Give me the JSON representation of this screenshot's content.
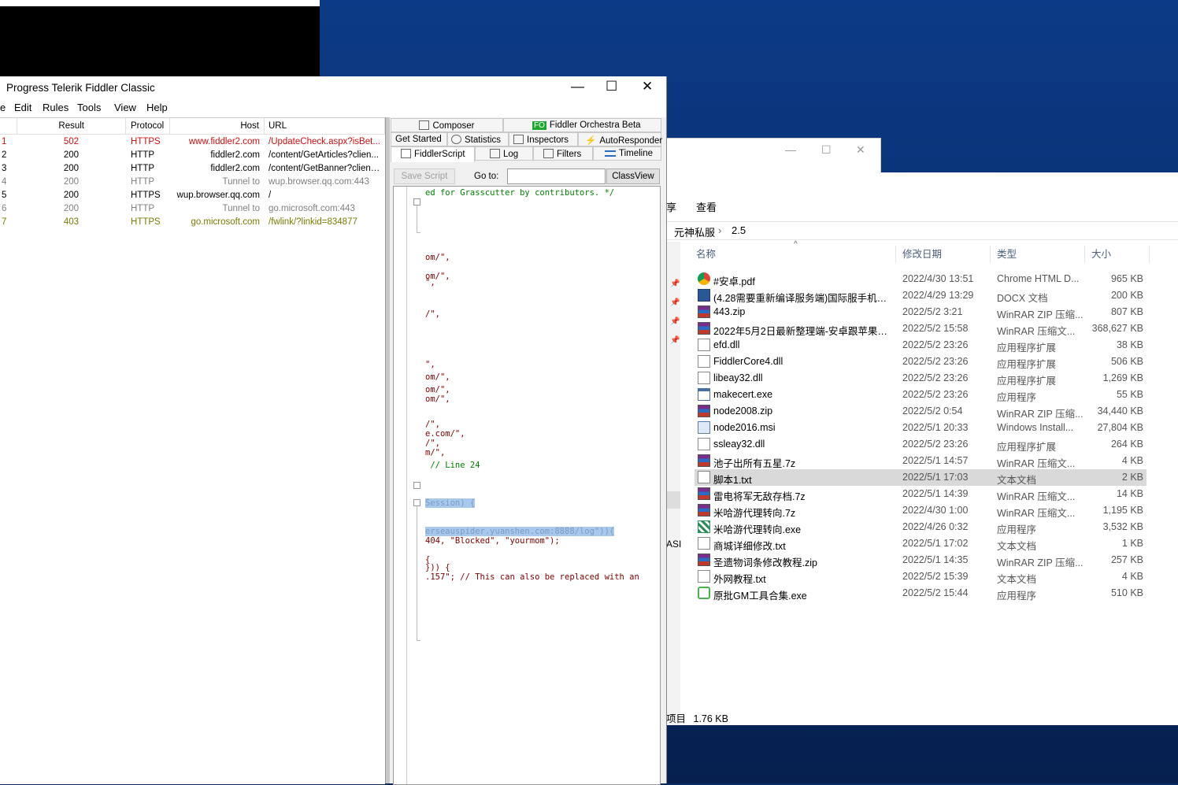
{
  "fiddler": {
    "title": "Progress Telerik Fiddler Classic",
    "window_controls": {
      "minimize": "—",
      "maximize": "☐",
      "close": "✕"
    },
    "menu": [
      "e",
      "Edit",
      "Rules",
      "Tools",
      "View",
      "Help"
    ],
    "columns": {
      "result": "Result",
      "protocol": "Protocol",
      "host": "Host",
      "url": "URL"
    },
    "sessions": [
      {
        "id": "1",
        "result": "502",
        "protocol": "HTTPS",
        "host": "www.fiddler2.com",
        "url": "/UpdateCheck.aspx?isBet...",
        "color": "#d01010"
      },
      {
        "id": "2",
        "result": "200",
        "protocol": "HTTP",
        "host": "fiddler2.com",
        "url": "/content/GetArticles?clien...",
        "color": "#000000"
      },
      {
        "id": "3",
        "result": "200",
        "protocol": "HTTP",
        "host": "fiddler2.com",
        "url": "/content/GetBanner?client...",
        "color": "#000000"
      },
      {
        "id": "4",
        "result": "200",
        "protocol": "HTTP",
        "host": "Tunnel to",
        "url": "wup.browser.qq.com:443",
        "color": "#808080"
      },
      {
        "id": "5",
        "result": "200",
        "protocol": "HTTPS",
        "host": "wup.browser.qq.com",
        "url": "/",
        "color": "#000000"
      },
      {
        "id": "6",
        "result": "200",
        "protocol": "HTTP",
        "host": "Tunnel to",
        "url": "go.microsoft.com:443",
        "color": "#808080"
      },
      {
        "id": "7",
        "result": "403",
        "protocol": "HTTPS",
        "host": "go.microsoft.com",
        "url": "/fwlink/?linkid=834877",
        "color": "#7a7a00"
      }
    ],
    "tabs_row1": [
      "Composer",
      "Fiddler Orchestra Beta"
    ],
    "fo_badge": "FO",
    "tabs_row2": [
      "Get Started",
      "Statistics",
      "Inspectors",
      "AutoResponder"
    ],
    "tabs_row3": [
      "FiddlerScript",
      "Log",
      "Filters",
      "Timeline"
    ],
    "toolbar": {
      "save_script": "Save Script",
      "goto_label": "Go to:",
      "goto_value": "",
      "classview": "ClassView"
    },
    "script_lines": [
      {
        "text": "ed for Grasscutter by contributors. */",
        "style": "cm"
      },
      {
        "text": "om/\",",
        "style": ""
      },
      {
        "text": "om/\",",
        "style": ""
      },
      {
        "text": "\",",
        "style": ""
      },
      {
        "text": "/\",",
        "style": ""
      },
      {
        "text": "\",",
        "style": ""
      },
      {
        "text": "om/\",",
        "style": ""
      },
      {
        "text": "om/\",",
        "style": ""
      },
      {
        "text": "om/\",",
        "style": ""
      },
      {
        "text": "/\",",
        "style": ""
      },
      {
        "text": "e.com/\",",
        "style": ""
      },
      {
        "text": "/\",",
        "style": ""
      },
      {
        "text": "m/\",",
        "style": ""
      },
      {
        "text": " // Line 24",
        "style": "cm"
      },
      {
        "text": "Session) {",
        "style": "sel"
      },
      {
        "text": "erseauspider.yuanshen.com:8888/log\")){",
        "style": "sel"
      },
      {
        "text": "404, \"Blocked\", \"yourmom\");",
        "style": ""
      },
      {
        "text": "{",
        "style": ""
      },
      {
        "text": "})) {",
        "style": ""
      },
      {
        "text": ".157\"; // This can also be replaced with an",
        "style": ""
      }
    ]
  },
  "explorer": {
    "window_controls": {
      "minimize": "—",
      "maximize": "☐",
      "close": "✕"
    },
    "ribbon": {
      "share": "享",
      "view": "查看"
    },
    "path": {
      "crumb1": "元神私服",
      "separator": "›",
      "crumb2": "2.5"
    },
    "sort_arrow": "^",
    "columns": {
      "name": "名称",
      "date": "修改日期",
      "type": "类型",
      "size": "大小"
    },
    "files": [
      {
        "name": "#安卓.pdf",
        "date": "2022/4/30 13:51",
        "type": "Chrome HTML D...",
        "size": "965 KB",
        "icon": "pdf-icon"
      },
      {
        "name": "(4.28需要重新编译服务端)国际服手机教...",
        "date": "2022/4/29 13:29",
        "type": "DOCX 文档",
        "size": "200 KB",
        "icon": "doc-icon"
      },
      {
        "name": "443.zip",
        "date": "2022/5/2 3:21",
        "type": "WinRAR ZIP 压缩...",
        "size": "807 KB",
        "icon": "rar-icon"
      },
      {
        "name": "2022年5月2日最新整理端-安卓跟苹果跟...",
        "date": "2022/5/2 15:58",
        "type": "WinRAR 压缩文...",
        "size": "368,627 KB",
        "icon": "rar-icon"
      },
      {
        "name": "efd.dll",
        "date": "2022/5/2 23:26",
        "type": "应用程序扩展",
        "size": "38 KB",
        "icon": "dll-icon"
      },
      {
        "name": "FiddlerCore4.dll",
        "date": "2022/5/2 23:26",
        "type": "应用程序扩展",
        "size": "506 KB",
        "icon": "dll-icon"
      },
      {
        "name": "libeay32.dll",
        "date": "2022/5/2 23:26",
        "type": "应用程序扩展",
        "size": "1,269 KB",
        "icon": "dll-icon"
      },
      {
        "name": "makecert.exe",
        "date": "2022/5/2 23:26",
        "type": "应用程序",
        "size": "55 KB",
        "icon": "exe-icon"
      },
      {
        "name": "node2008.zip",
        "date": "2022/5/2 0:54",
        "type": "WinRAR ZIP 压缩...",
        "size": "34,440 KB",
        "icon": "rar-icon"
      },
      {
        "name": "node2016.msi",
        "date": "2022/5/1 20:33",
        "type": "Windows Install...",
        "size": "27,804 KB",
        "icon": "msi-icon"
      },
      {
        "name": "ssleay32.dll",
        "date": "2022/5/2 23:26",
        "type": "应用程序扩展",
        "size": "264 KB",
        "icon": "dll-icon"
      },
      {
        "name": "池子出所有五星.7z",
        "date": "2022/5/1 14:57",
        "type": "WinRAR 压缩文...",
        "size": "4 KB",
        "icon": "rar-icon"
      },
      {
        "name": "脚本1.txt",
        "date": "2022/5/1 17:03",
        "type": "文本文档",
        "size": "2 KB",
        "icon": "txt-icon",
        "selected": true
      },
      {
        "name": "雷电将军无敌存档.7z",
        "date": "2022/5/1 14:39",
        "type": "WinRAR 压缩文...",
        "size": "14 KB",
        "icon": "rar-icon"
      },
      {
        "name": "米哈游代理转向.7z",
        "date": "2022/4/30 1:00",
        "type": "WinRAR 压缩文...",
        "size": "1,195 KB",
        "icon": "rar-icon"
      },
      {
        "name": "米哈游代理转向.exe",
        "date": "2022/4/26 0:32",
        "type": "应用程序",
        "size": "3,532 KB",
        "icon": "mhy-icon"
      },
      {
        "name": "商城详细修改.txt",
        "date": "2022/5/1 17:02",
        "type": "文本文档",
        "size": "1 KB",
        "icon": "txt-icon"
      },
      {
        "name": "圣遗物词条修改教程.zip",
        "date": "2022/5/1 14:35",
        "type": "WinRAR ZIP 压缩...",
        "size": "257 KB",
        "icon": "rar-icon"
      },
      {
        "name": "外网教程.txt",
        "date": "2022/5/2 15:39",
        "type": "文本文档",
        "size": "4 KB",
        "icon": "txt-icon"
      },
      {
        "name": "原批GM工具合集.exe",
        "date": "2022/5/2 15:44",
        "type": "应用程序",
        "size": "510 KB",
        "icon": "gm-icon"
      }
    ],
    "side_fragment": "ASI",
    "status": {
      "items": "项目",
      "size": "1.76 KB"
    }
  }
}
